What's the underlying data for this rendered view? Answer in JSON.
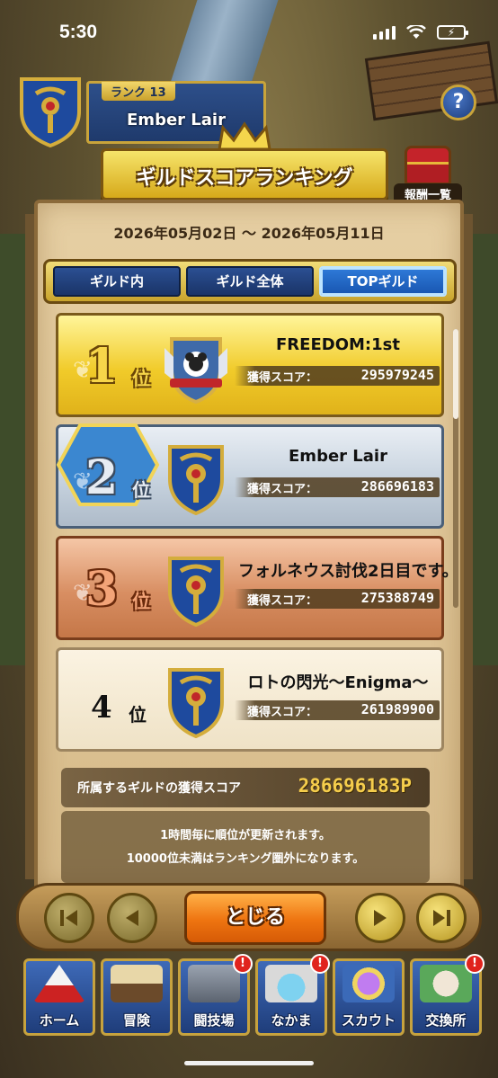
{
  "status": {
    "time": "5:30"
  },
  "guild_header": {
    "rank_label": "ランク 13",
    "guild_name": "Ember Lair"
  },
  "title": "ギルドスコアランキング",
  "reward_label": "報酬一覧",
  "date_range": "2026年05月02日 〜 2026年05月11日",
  "tabs": [
    {
      "label": "ギルド内",
      "active": false
    },
    {
      "label": "ギルド全体",
      "active": false
    },
    {
      "label": "TOPギルド",
      "active": true
    }
  ],
  "rankings": [
    {
      "rank": "1",
      "suffix": "位",
      "name": "FREEDOM:1st",
      "score_label": "獲得スコア：",
      "score": "295979245"
    },
    {
      "rank": "2",
      "suffix": "位",
      "name": "Ember Lair",
      "score_label": "獲得スコア：",
      "score": "286696183"
    },
    {
      "rank": "3",
      "suffix": "位",
      "name": "フォルネウス討伐2日目です。",
      "score_label": "獲得スコア：",
      "score": "275388749"
    },
    {
      "rank": "4",
      "suffix": "位",
      "name": "ロトの閃光〜Enigma〜",
      "score_label": "獲得スコア：",
      "score": "261989900"
    }
  ],
  "own_score": {
    "label": "所属するギルドの獲得スコア",
    "value": "286696183P"
  },
  "info": {
    "line1": "1時間毎に順位が更新されます。",
    "line2": "10000位未満はランキング圏外になります。"
  },
  "controls": {
    "close_label": "とじる"
  },
  "nav": [
    {
      "label": "ホーム",
      "icon": "tent-icon",
      "badge": ""
    },
    {
      "label": "冒険",
      "icon": "wagon-icon",
      "badge": ""
    },
    {
      "label": "闘技場",
      "icon": "castle-icon",
      "badge": "!"
    },
    {
      "label": "なかま",
      "icon": "party-icon",
      "badge": "!"
    },
    {
      "label": "スカウト",
      "icon": "crystal-icon",
      "badge": ""
    },
    {
      "label": "交換所",
      "icon": "merchant-icon",
      "badge": "!"
    }
  ],
  "colors": {
    "accent_gold": "#e0b21a",
    "tab_active": "#1855b0",
    "close_orange": "#ee7410",
    "badge_red": "#e0231d"
  }
}
